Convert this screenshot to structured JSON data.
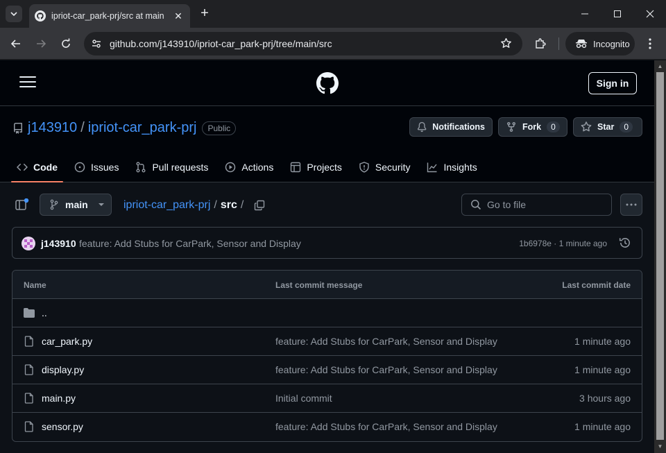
{
  "browser": {
    "tab_title": "ipriot-car_park-prj/src at main",
    "url": "github.com/j143910/ipriot-car_park-prj/tree/main/src",
    "incognito_label": "Incognito"
  },
  "header": {
    "signin_label": "Sign in"
  },
  "repo": {
    "owner": "j143910",
    "separator": "/",
    "name": "ipriot-car_park-prj",
    "visibility": "Public",
    "notifications_label": "Notifications",
    "fork_label": "Fork",
    "fork_count": "0",
    "star_label": "Star",
    "star_count": "0",
    "tabs": [
      {
        "label": "Code"
      },
      {
        "label": "Issues"
      },
      {
        "label": "Pull requests"
      },
      {
        "label": "Actions"
      },
      {
        "label": "Projects"
      },
      {
        "label": "Security"
      },
      {
        "label": "Insights"
      }
    ]
  },
  "filebar": {
    "branch": "main",
    "crumb_repo": "ipriot-car_park-prj",
    "crumb_sep": "/",
    "crumb_current": "src",
    "crumb_trailing": "/",
    "goto_placeholder": "Go to file"
  },
  "commit": {
    "author": "j143910",
    "message": "feature: Add Stubs for CarPark, Sensor and Display",
    "meta": "1b6978e · 1 minute ago"
  },
  "table": {
    "headers": {
      "name": "Name",
      "message": "Last commit message",
      "date": "Last commit date"
    },
    "parent": "..",
    "rows": [
      {
        "name": "car_park.py",
        "message": "feature: Add Stubs for CarPark, Sensor and Display",
        "date": "1 minute ago"
      },
      {
        "name": "display.py",
        "message": "feature: Add Stubs for CarPark, Sensor and Display",
        "date": "1 minute ago"
      },
      {
        "name": "main.py",
        "message": "Initial commit",
        "date": "3 hours ago"
      },
      {
        "name": "sensor.py",
        "message": "feature: Add Stubs for CarPark, Sensor and Display",
        "date": "1 minute ago"
      }
    ]
  },
  "colors": {
    "accent_link": "#4493f8",
    "active_tab_underline": "#f78166",
    "page_bg": "#0d1117"
  }
}
